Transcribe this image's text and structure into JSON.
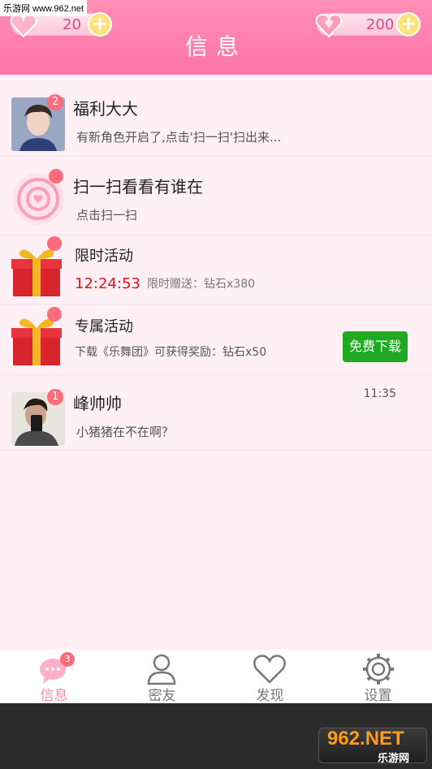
{
  "watermark": {
    "top_text": "乐游网 www.962.net",
    "bottom_text": "962.NET",
    "bottom_sub": "乐游网"
  },
  "header": {
    "title": "信息",
    "left_counter": "20",
    "right_counter": "200",
    "plus": "+"
  },
  "items": [
    {
      "name": "福利大大",
      "badge": "2",
      "subtitle": "有新角色开启了,点击'扫一扫'扫出来..."
    },
    {
      "name": "扫一扫看看有谁在",
      "subtitle": "点击扫一扫"
    },
    {
      "name": "限时活动",
      "countdown": "12:24:53",
      "subtitle": "限时赠送：钻石x380"
    },
    {
      "name": "专属活动",
      "subtitle": "下载《乐舞团》可获得奖励：钻石x50",
      "button": "免费下载"
    },
    {
      "name": "峰帅帅",
      "badge": "1",
      "time": "11:35",
      "subtitle": "小猪猪在不在啊？"
    }
  ],
  "nav": {
    "items": [
      {
        "label": "信息",
        "badge": "3"
      },
      {
        "label": "密友"
      },
      {
        "label": "发现"
      },
      {
        "label": "设置"
      }
    ]
  },
  "colors": {
    "header": "#ff7aa9",
    "accent": "#ff86ad",
    "badge": "#ff6b7a",
    "green": "#1faa22"
  }
}
